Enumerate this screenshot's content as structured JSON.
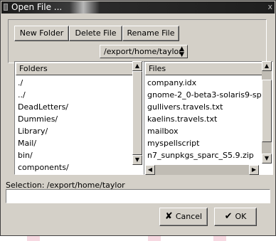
{
  "dialog": {
    "title": "Open File ...",
    "close_glyph": "x"
  },
  "toolbar": {
    "new_folder": "New Folder",
    "delete_file": "Delete File",
    "rename_file": "Rename File"
  },
  "path_dropdown": {
    "value": "/export/home/taylor",
    "arrows": "▲▼"
  },
  "folders": {
    "header": "Folders",
    "items": [
      "./",
      "../",
      "DeadLetters/",
      "Dummies/",
      "Library/",
      "Mail/",
      "bin/",
      "components/"
    ]
  },
  "files": {
    "header": "Files",
    "items": [
      "company.idx",
      "gnome-2_0-beta3-solaris9-sp",
      "gullivers.travels.txt",
      "kaelins.travels.txt",
      "mailbox",
      "myspellscript",
      "n7_sunpkgs_sparc_S5.9.zip"
    ]
  },
  "selection": {
    "label": "Selection: /export/home/taylor",
    "value": ""
  },
  "actions": {
    "cancel": "Cancel",
    "ok": "OK",
    "cancel_icon": "cross-icon",
    "ok_icon": "check-icon"
  }
}
